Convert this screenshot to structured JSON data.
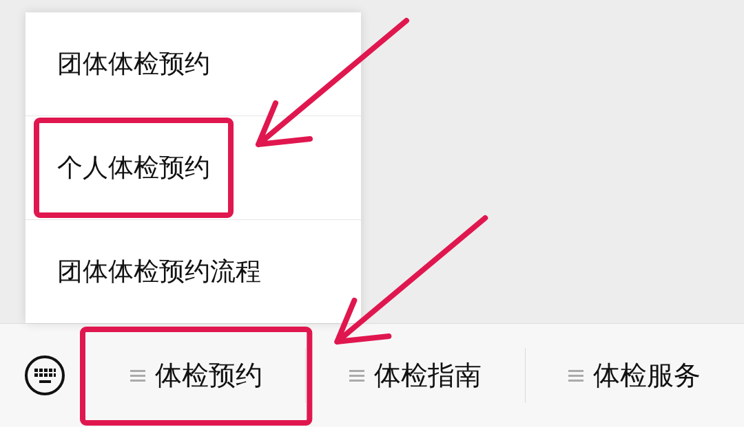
{
  "popup_menu": {
    "items": [
      {
        "label": "团体体检预约",
        "highlighted": false
      },
      {
        "label": "个人体检预约",
        "highlighted": true
      },
      {
        "label": "团体体检预约流程",
        "highlighted": false
      }
    ]
  },
  "bottom_menu": {
    "items": [
      {
        "label": "体检预约",
        "highlighted": true
      },
      {
        "label": "体检指南",
        "highlighted": false
      },
      {
        "label": "体检服务",
        "highlighted": false
      }
    ]
  }
}
